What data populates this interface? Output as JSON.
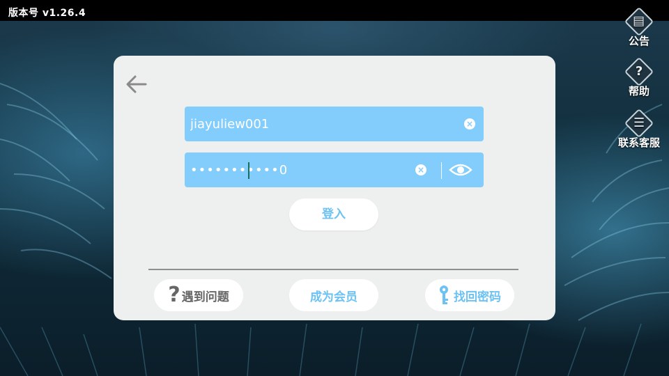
{
  "status_bar": {
    "version": "版本号 v1.26.4"
  },
  "side_menu": [
    {
      "label": "公告",
      "icon": "notice-board-icon"
    },
    {
      "label": "帮助",
      "icon": "help-question-icon"
    },
    {
      "label": "联系客服",
      "icon": "customer-service-list-icon"
    }
  ],
  "login": {
    "username": "jiayuliew001",
    "password_display": "•••••••••••0",
    "login_label": "登入"
  },
  "footer_buttons": {
    "problem": "遇到问题",
    "member": "成为会员",
    "find_password": "找回密码"
  },
  "colors": {
    "field_bg": "#82cdfb",
    "accent_text": "#6cc2f2",
    "card_bg": "#eeefef"
  }
}
